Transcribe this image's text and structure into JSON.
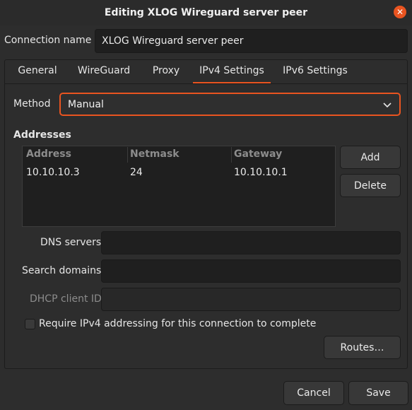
{
  "window": {
    "title": "Editing XLOG Wireguard server peer",
    "close_icon": "close-icon"
  },
  "connection": {
    "label": "Connection name",
    "value": "XLOG Wireguard server peer"
  },
  "tabs": [
    {
      "label": "General"
    },
    {
      "label": "WireGuard"
    },
    {
      "label": "Proxy"
    },
    {
      "label": "IPv4 Settings",
      "active": true
    },
    {
      "label": "IPv6 Settings"
    }
  ],
  "ipv4": {
    "method_label": "Method",
    "method_value": "Manual",
    "addresses_heading": "Addresses",
    "columns": [
      "Address",
      "Netmask",
      "Gateway"
    ],
    "rows": [
      [
        "10.10.10.3",
        "24",
        "10.10.10.1"
      ]
    ],
    "add_label": "Add",
    "delete_label": "Delete",
    "dns_label": "DNS servers",
    "dns_value": "",
    "search_label": "Search domains",
    "search_value": "",
    "dhcp_label": "DHCP client ID",
    "dhcp_value": "",
    "require_label": "Require IPv4 addressing for this connection to complete",
    "require_checked": false,
    "routes_label": "Routes…"
  },
  "footer": {
    "cancel_label": "Cancel",
    "save_label": "Save"
  },
  "colors": {
    "accent": "#e95420",
    "background": "#2d2d2d"
  }
}
